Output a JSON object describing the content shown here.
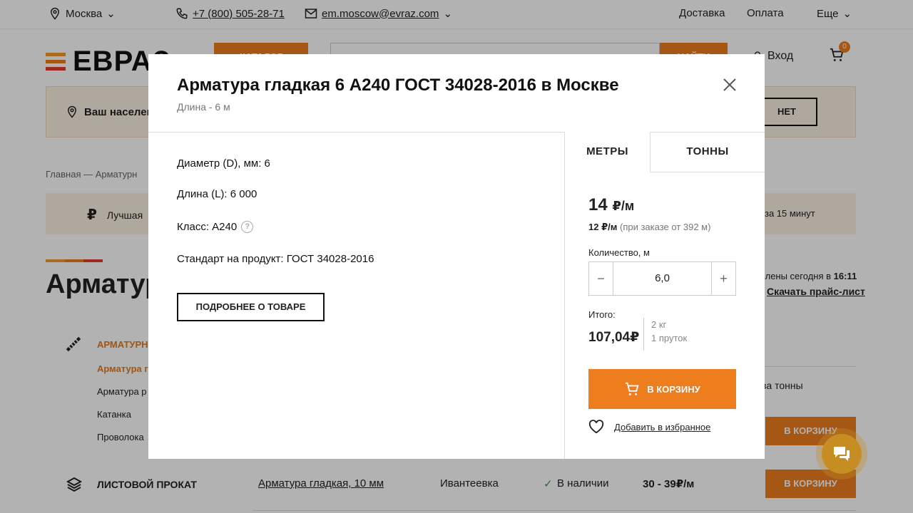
{
  "topbar": {
    "city": "Москва",
    "phone": "+7 (800) 505-28-71",
    "email": "em.moscow@evraz.com",
    "links": [
      "Доставка",
      "Оплата",
      "Еще"
    ]
  },
  "header": {
    "logo": "ЕВРАЗ",
    "catalog_label": "КАТАЛОГ",
    "search_button": "НАЙТИ",
    "login": "Вход",
    "cart_count": "0"
  },
  "city_band": {
    "text": "Ваш населен",
    "no_label": "НЕТ"
  },
  "breadcrumbs": "Главная — Арматурн",
  "promo": {
    "left": "Лучшая",
    "right": "за 15 минут"
  },
  "page": {
    "title": "Арматур",
    "updated_prefix": "влены сегодня в",
    "updated_time": "16:11",
    "pricelist": "Скачать прайс-лист"
  },
  "sidebar": {
    "category": "АРМАТУРН",
    "items": [
      "Арматура г",
      "Арматура р",
      "Катанка",
      "Проволока"
    ],
    "category2": "ЛИСТОВОЙ ПРОКАТ"
  },
  "table_rows": [
    {
      "tonnage": "за тонны",
      "cart": "В КОРЗИНУ"
    },
    {
      "name": "Арматура гладкая, 10 мм",
      "city": "Ивантеевка",
      "availability": "В наличии",
      "price": "30 - 39₽/м",
      "cart": "В КОРЗИНУ"
    }
  ],
  "modal": {
    "title": "Арматура гладкая 6 А240 ГОСТ 34028-2016 в Москве",
    "subtitle": "Длина - 6 м",
    "specs": [
      "Диаметр (D), мм: 6",
      "Длина (L): 6 000",
      "Класс: А240",
      "Стандарт на продукт: ГОСТ 34028-2016"
    ],
    "more_button": "ПОДРОБНЕЕ О ТОВАРЕ",
    "tabs": [
      "МЕТРЫ",
      "ТОННЫ"
    ],
    "price": "14",
    "price_unit": "₽/м",
    "bulk_price": "12 ₽/м",
    "bulk_condition": "(при заказе от 392 м)",
    "quantity_label": "Количество, м",
    "quantity_value": "6,0",
    "total_label": "Итого:",
    "total_value": "107,04₽",
    "total_weight": "2 кг",
    "total_pieces": "1 пруток",
    "cart_button": "В КОРЗИНУ",
    "favorite": "Добавить в избранное"
  },
  "colors": {
    "accent": "#ee7d1d",
    "logo_orange": "#f29a2e",
    "logo_red": "#e33c2a",
    "chat": "#c68e22"
  }
}
